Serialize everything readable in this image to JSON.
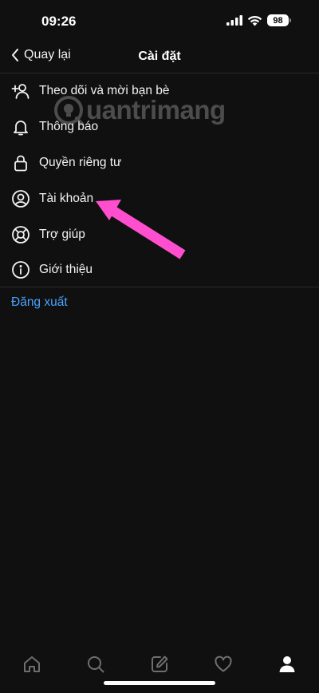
{
  "status_bar": {
    "time": "09:26",
    "battery": "98"
  },
  "nav": {
    "back_label": "Quay lại",
    "title": "Cài đặt"
  },
  "menu": {
    "items": [
      {
        "label": "Theo dõi và mời bạn bè",
        "icon": "add-person-icon"
      },
      {
        "label": "Thông báo",
        "icon": "bell-icon"
      },
      {
        "label": "Quyền riêng tư",
        "icon": "lock-icon"
      },
      {
        "label": "Tài khoản",
        "icon": "account-circle-icon"
      },
      {
        "label": "Trợ giúp",
        "icon": "lifebuoy-icon"
      },
      {
        "label": "Giới thiệu",
        "icon": "info-icon"
      }
    ]
  },
  "logout_label": "Đăng xuất",
  "watermark": "uantrimang",
  "colors": {
    "background": "#101010",
    "link": "#4aa3ff",
    "arrow": "#ff4fcf"
  },
  "tab_bar": {
    "tabs": [
      "home-icon",
      "search-icon",
      "compose-icon",
      "heart-icon",
      "profile-icon"
    ],
    "active": "profile-icon"
  }
}
